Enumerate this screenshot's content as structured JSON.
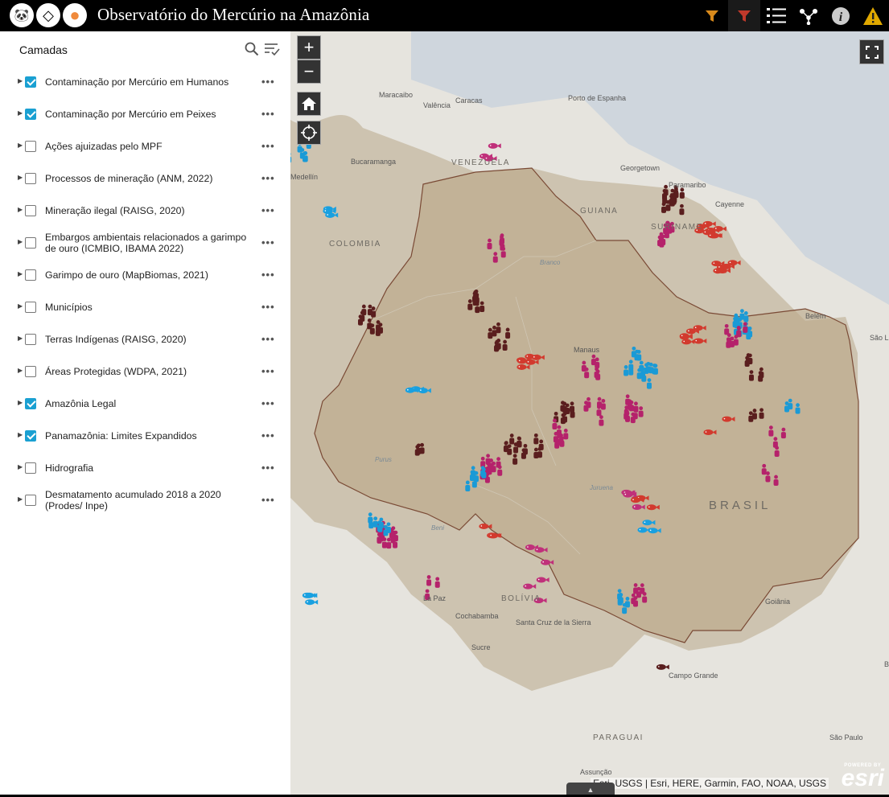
{
  "app": {
    "title": "Observatório do Mercúrio na Amazônia",
    "logos": [
      {
        "icon": "panda-icon",
        "glyph": "🐼"
      },
      {
        "icon": "bag-icon",
        "glyph": "◇"
      },
      {
        "icon": "orange-logo-icon",
        "glyph": "●"
      }
    ]
  },
  "header_tools": [
    {
      "name": "filter-orange-icon",
      "color": "#d98a1c"
    },
    {
      "name": "filter-red-icon",
      "color": "#c0392b"
    },
    {
      "name": "layer-list-icon",
      "color": "#ffffff"
    },
    {
      "name": "share-icon",
      "color": "#ffffff"
    },
    {
      "name": "info-icon",
      "color": "#ffffff"
    },
    {
      "name": "warning-icon",
      "color": "#e0a800"
    }
  ],
  "panel": {
    "title": "Camadas",
    "layers": [
      {
        "label": "Contaminação por Mercúrio em Humanos",
        "checked": true
      },
      {
        "label": "Contaminação por Mercúrio em Peixes",
        "checked": true
      },
      {
        "label": "Ações ajuizadas pelo MPF",
        "checked": false
      },
      {
        "label": "Processos de mineração (ANM, 2022)",
        "checked": false
      },
      {
        "label": "Mineração ilegal (RAISG, 2020)",
        "checked": false
      },
      {
        "label": "Embargos ambientais relacionados a garimpo de ouro (ICMBIO, IBAMA 2022)",
        "checked": false
      },
      {
        "label": "Garimpo de ouro (MapBiomas, 2021)",
        "checked": false
      },
      {
        "label": "Municípios",
        "checked": false
      },
      {
        "label": "Terras Indígenas (RAISG, 2020)",
        "checked": false
      },
      {
        "label": "Áreas Protegidas (WDPA, 2021)",
        "checked": false
      },
      {
        "label": "Amazônia Legal",
        "checked": true
      },
      {
        "label": "Panamazônia: Limites Expandidos",
        "checked": true
      },
      {
        "label": "Hidrografia",
        "checked": false
      },
      {
        "label": "Desmatamento acumulado 2018 a 2020 (Prodes/ Inpe)",
        "checked": false
      }
    ],
    "more_glyph": "•••"
  },
  "map": {
    "zoom_in": "+",
    "zoom_out": "−",
    "attribution": "Esri, USGS | Esri, HERE, Garmin, FAO, NOAA, USGS",
    "esri_powered": "POWERED BY",
    "esri_name": "esri",
    "labels": [
      {
        "text": "BRASIL",
        "cls": "country"
      },
      {
        "text": "COLOMBIA",
        "cls": "country"
      },
      {
        "text": "VENEZUELA",
        "cls": "country"
      },
      {
        "text": "BOLÍVIA",
        "cls": "country"
      },
      {
        "text": "PARAGUAI",
        "cls": "country"
      },
      {
        "text": "GUIANA",
        "cls": "country"
      },
      {
        "text": "SURINAME",
        "cls": "country"
      },
      {
        "text": "Maracaibo",
        "cls": "city"
      },
      {
        "text": "Caracas",
        "cls": "city"
      },
      {
        "text": "Valência",
        "cls": "city"
      },
      {
        "text": "Porto de Espanha",
        "cls": "city"
      },
      {
        "text": "Georgetown",
        "cls": "city"
      },
      {
        "text": "Paramaribo",
        "cls": "city"
      },
      {
        "text": "Cayenne",
        "cls": "city"
      },
      {
        "text": "Belém",
        "cls": "city"
      },
      {
        "text": "São Luís",
        "cls": "city"
      },
      {
        "text": "Manaus",
        "cls": "city"
      },
      {
        "text": "Bucaramanga",
        "cls": "city"
      },
      {
        "text": "Medellín",
        "cls": "city"
      },
      {
        "text": "Cochabamba",
        "cls": "city"
      },
      {
        "text": "Santa Cruz de la Sierra",
        "cls": "city"
      },
      {
        "text": "Sucre",
        "cls": "city"
      },
      {
        "text": "La Paz",
        "cls": "city"
      },
      {
        "text": "Campo Grande",
        "cls": "city"
      },
      {
        "text": "Goiânia",
        "cls": "city"
      },
      {
        "text": "Belo Horizonte",
        "cls": "city"
      },
      {
        "text": "São Paulo",
        "cls": "city"
      },
      {
        "text": "Assunção",
        "cls": "city"
      },
      {
        "text": "Purus",
        "cls": "river"
      },
      {
        "text": "Juruena",
        "cls": "river"
      },
      {
        "text": "Beni",
        "cls": "river"
      },
      {
        "text": "Branco",
        "cls": "river"
      }
    ]
  },
  "legend_colors": {
    "human_dark": "#5a1e1e",
    "human_pink": "#b5226b",
    "human_blue": "#1a9ad6",
    "fish_red": "#d23a2e",
    "fish_pink": "#c0307a",
    "fish_blue": "#19a0e0"
  }
}
